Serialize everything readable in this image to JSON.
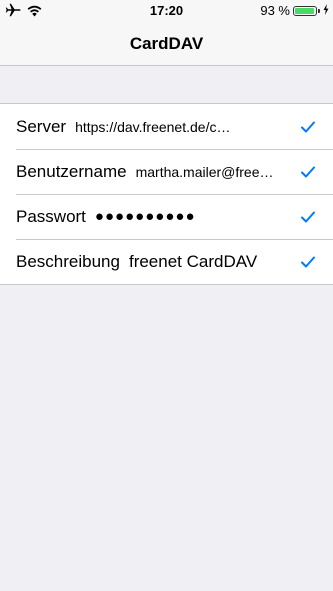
{
  "status_bar": {
    "time": "17:20",
    "battery_percent_label": "93 %",
    "battery_level": 0.93,
    "icons": [
      "airplane-icon",
      "wifi-icon",
      "battery-icon",
      "charging-icon"
    ]
  },
  "nav": {
    "title": "CardDAV"
  },
  "form": {
    "rows": [
      {
        "label": "Server",
        "value": "https://dav.freenet.de/c…",
        "valid": true
      },
      {
        "label": "Benutzername",
        "value": "martha.mailer@free…",
        "valid": true
      },
      {
        "label": "Passwort",
        "value": "●●●●●●●●●●",
        "valid": true
      },
      {
        "label": "Beschreibung",
        "value": "freenet CardDAV",
        "valid": true
      }
    ]
  },
  "colors": {
    "accent": "#007aff",
    "battery_fill": "#4cd964",
    "background": "#efeff4"
  }
}
